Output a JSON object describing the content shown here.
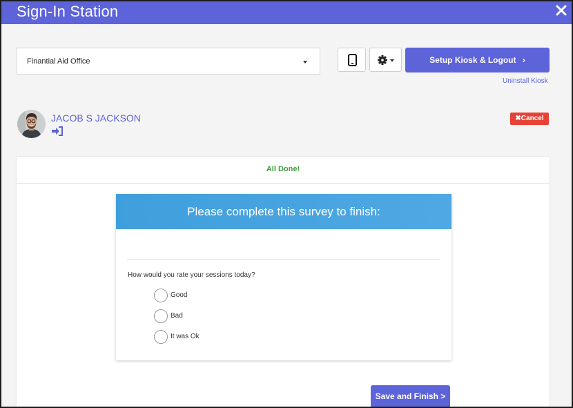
{
  "window": {
    "title": "Sign-In Station",
    "close_icon": "close-icon"
  },
  "toolbar": {
    "location_select": {
      "value": "Finantial Aid Office"
    },
    "phone_icon": "mobile-phone-icon",
    "settings_icon": "gear-icon",
    "setup_button_label": "Setup Kiosk & Logout",
    "setup_button_arrow": "›",
    "uninstall_link": "Uninstall Kiosk"
  },
  "user": {
    "name": "JACOB S JACKSON",
    "sign_in_icon": "sign-in-icon",
    "cancel_label": "✖Cancel"
  },
  "panel": {
    "status": "All Done!",
    "survey": {
      "header": "Please complete this survey to finish:",
      "question": "How would you rate your sessions today?",
      "options": [
        "Good",
        "Bad",
        "It was Ok"
      ]
    },
    "submit_label": "Save and Finish >"
  },
  "colors": {
    "brand": "#5d63d9",
    "survey_header": "#4aa3e0",
    "success": "#3f9d3a",
    "danger": "#e74235"
  }
}
